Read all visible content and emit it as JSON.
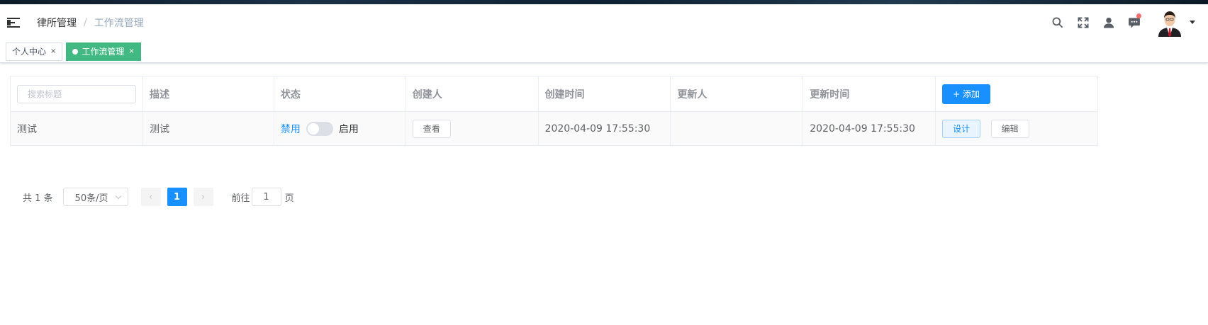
{
  "navbar": {
    "breadcrumb": [
      "律所管理",
      "工作流管理"
    ],
    "breadcrumb_separator": "/"
  },
  "tags": [
    {
      "label": "个人中心",
      "close": "×",
      "active": false
    },
    {
      "label": "工作流管理",
      "close": "×",
      "active": true
    }
  ],
  "table": {
    "search_placeholder": "搜索标题",
    "headers": [
      "描述",
      "状态",
      "创建人",
      "创建时间",
      "更新人",
      "更新时间"
    ],
    "add_button_label": "+ 添加",
    "rows": [
      {
        "title": "测试",
        "description": "测试",
        "status_off_label": "禁用",
        "status_on_label": "启用",
        "status_enabled": false,
        "creator_button": "查看",
        "created_at": "2020-04-09 17:55:30",
        "updater": "",
        "updated_at": "2020-04-09 17:55:30",
        "design_button": "设计",
        "edit_button": "编辑"
      }
    ]
  },
  "pagination": {
    "total_text": "共 1 条",
    "page_size": "50条/页",
    "current_page": "1",
    "prev": "‹",
    "next": "›",
    "goto_prefix": "前往",
    "goto_value": "1",
    "goto_suffix": "页"
  },
  "colors": {
    "primary": "#1890ff",
    "active_tag": "#42b983",
    "notification_dot": "#f56c6c"
  }
}
